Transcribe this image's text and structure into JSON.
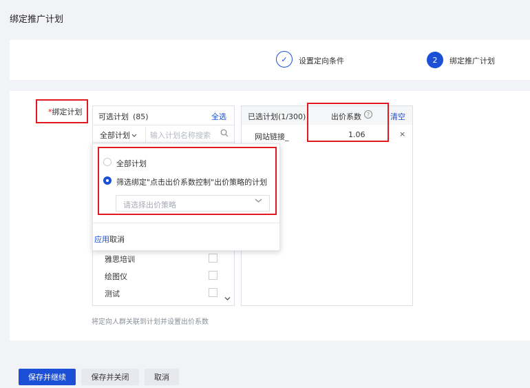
{
  "page": {
    "title": "绑定推广计划"
  },
  "steps": [
    {
      "indicator": "✓",
      "label": "设置定向条件",
      "state": "done"
    },
    {
      "indicator": "2",
      "label": "绑定推广计划",
      "state": "active"
    }
  ],
  "form": {
    "required_mark": "*",
    "bind_label": "绑定计划",
    "hint": "将定向人群关联到计划并设置出价系数"
  },
  "available_plans": {
    "title": "可选计划",
    "count": "(85)",
    "select_all": "全选",
    "filter_label": "全部计划",
    "search_placeholder": "输入计划名称搜索",
    "items": [
      "雅思培训",
      "绘图仪",
      "测试"
    ]
  },
  "filter_dropdown": {
    "options": [
      "全部计划",
      "筛选绑定\"点击出价系数控制\"出价策略的计划"
    ],
    "selected_index": 1,
    "strategy_placeholder": "请选择出价策略",
    "apply": "应用",
    "cancel": "取消"
  },
  "selected_plans": {
    "title": "已选计划(1/300)",
    "coef_header": "出价系数",
    "help_icon": "?",
    "clear": "清空",
    "rows": [
      {
        "name": "网站链接_",
        "coef": "1.06",
        "remove": "×"
      }
    ]
  },
  "buttons": {
    "save_continue": "保存并继续",
    "save_close": "保存并关闭",
    "cancel": "取消"
  },
  "colors": {
    "primary": "#1a4fd6",
    "highlight": "#e0191e"
  }
}
